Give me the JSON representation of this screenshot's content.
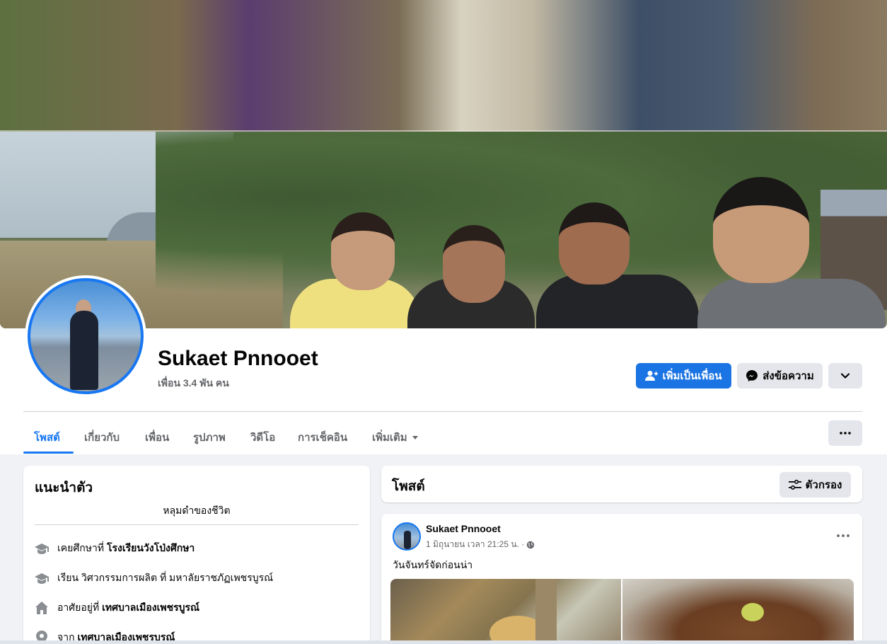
{
  "profile": {
    "name": "Sukaet Pnnooet",
    "friends_count": "เพื่อน 3.4 พัน คน"
  },
  "actions": {
    "add_friend": "เพิ่มเป็นเพื่อน",
    "message": "ส่งข้อความ"
  },
  "tabs": [
    {
      "label": "โพสต์",
      "active": true
    },
    {
      "label": "เกี่ยวกับ"
    },
    {
      "label": "เพื่อน"
    },
    {
      "label": "รูปภาพ"
    },
    {
      "label": "วิดีโอ"
    },
    {
      "label": "การเช็คอิน"
    },
    {
      "label": "เพิ่มเติม"
    }
  ],
  "intro": {
    "title": "แนะนำตัว",
    "bio": "หลุมดำของชีวิต",
    "items": [
      {
        "icon": "graduation-cap-icon",
        "prefix": "เคยศึกษาที่ ",
        "bold": "โรงเรียนวังโป่งศึกษา"
      },
      {
        "icon": "graduation-cap-icon",
        "prefix": "เรียน วิศวกรรมการผลิต ที่ มหาลัยราชภัฏเพชรบูรณ์",
        "bold": ""
      },
      {
        "icon": "home-icon",
        "prefix": "อาศัยอยู่ที่ ",
        "bold": "เทศบาลเมืองเพชรบูรณ์"
      },
      {
        "icon": "location-pin-icon",
        "prefix": "จาก ",
        "bold": "เทศบาลเมืองเพชรบูรณ์"
      }
    ]
  },
  "posts": {
    "title": "โพสต์",
    "filter_label": "ตัวกรอง"
  },
  "post": {
    "author": "Sukaet Pnnooet",
    "timestamp": "1 มิถุนายน เวลา 21:25 น. ·",
    "privacy_icon": "globe-icon",
    "text": "วันจันทร์จัดก่อนน่า"
  },
  "colors": {
    "accent": "#1877f2",
    "button_gray": "#e4e6eb",
    "background": "#f0f2f5",
    "secondary_text": "#65676b"
  }
}
